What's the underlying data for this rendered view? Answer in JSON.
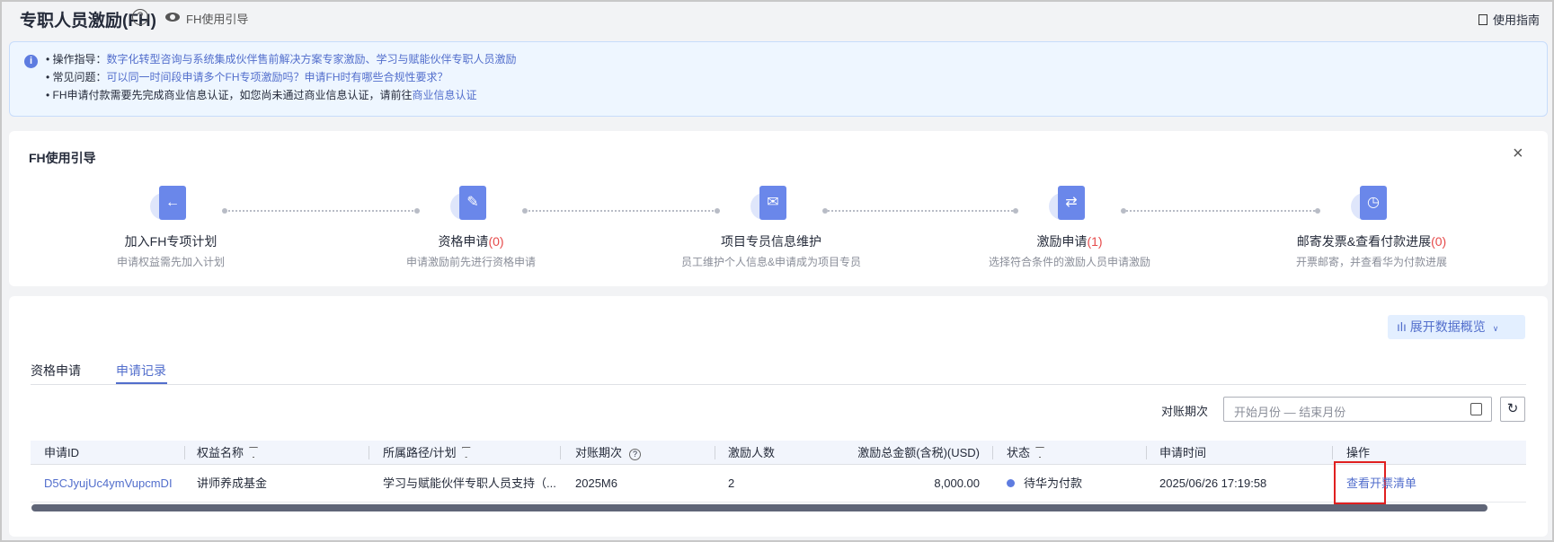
{
  "header": {
    "title": "专职人员激励(FH)",
    "help_icon": "?",
    "guide_link": "FH使用引导",
    "manual": "使用指南"
  },
  "notice": {
    "lines": [
      {
        "prefix": "• 操作指导：",
        "link": "数字化转型咨询与系统集成伙伴售前解决方案专家激励、学习与赋能伙伴专职人员激励"
      },
      {
        "prefix": "• 常见问题：",
        "link": "可以同一时间段申请多个FH专项激励吗？申请FH时有哪些合规性要求？"
      },
      {
        "prefix": "• FH申请付款需要先完成商业信息认证，如您尚未通过商业信息认证，请前往",
        "link": "商业信息认证"
      }
    ]
  },
  "guide": {
    "title": "FH使用引导",
    "close": "×",
    "steps": [
      {
        "label": "加入FH专项计划",
        "count": "",
        "sub": "申请权益需先加入计划",
        "glyph": "←"
      },
      {
        "label": "资格申请",
        "count": "(0)",
        "sub": "申请激励前先进行资格申请",
        "glyph": "✎"
      },
      {
        "label": "项目专员信息维护",
        "count": "",
        "sub": "员工维护个人信息&申请成为项目专员",
        "glyph": "✉"
      },
      {
        "label": "激励申请",
        "count": "(1)",
        "sub": "选择符合条件的激励人员申请激励",
        "glyph": "⇄"
      },
      {
        "label": "邮寄发票&查看付款进展",
        "count": "(0)",
        "sub": "开票邮寄，并查看华为付款进展",
        "glyph": "◷"
      }
    ]
  },
  "records": {
    "expand_button": "展开数据概览",
    "tabs": [
      "资格申请",
      "申请记录"
    ],
    "active_tab": 1,
    "filter_label": "对账期次",
    "date_placeholder": "开始月份 — 结束月份",
    "columns": [
      "申请ID",
      "权益名称",
      "所属路径/计划",
      "对账期次",
      "激励人数",
      "激励总金额(含税)(USD)",
      "状态",
      "申请时间",
      "操作"
    ],
    "rows": [
      {
        "id": "D5CJyujUc4ymVupcmDI",
        "benefit": "讲师养成基金",
        "plan": "学习与赋能伙伴专职人员支持（...",
        "period": "2025M6",
        "count": "2",
        "amount": "8,000.00",
        "status": "待华为付款",
        "time": "2025/06/26 17:19:58",
        "action": "查看开票清单"
      }
    ]
  },
  "colors": {
    "accent": "#526ecc",
    "status_dot": "#5e7ce0",
    "highlight": "#e02020"
  }
}
